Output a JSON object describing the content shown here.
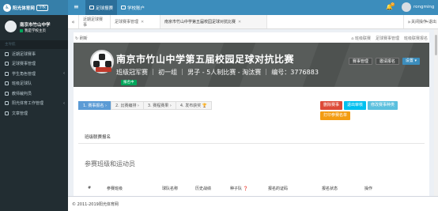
{
  "topbar": {
    "logo_mark": "♿",
    "logo_text": "阳光体育网",
    "logo_badge": "学校",
    "nav": [
      {
        "label": "足球报赛"
      },
      {
        "label": "学校账户"
      }
    ],
    "notification_count": "0",
    "user_name": "rongming"
  },
  "sidebar": {
    "school": "南京市竹山中学",
    "status": "我是学校主页",
    "section_header": "主导航",
    "items": [
      {
        "label": "近期足球赛事"
      },
      {
        "label": "足球赛事管理"
      },
      {
        "label": "学生角色管理"
      },
      {
        "label": "班级足球队"
      },
      {
        "label": "教师裁判员"
      },
      {
        "label": "阳光体育工作管理"
      },
      {
        "label": "文章管理"
      }
    ]
  },
  "tabs": {
    "items": [
      {
        "label": "近期足球赛事"
      },
      {
        "label": "足球赛事管理"
      },
      {
        "label": "南京市竹山中学第五届校园足球对抗比赛"
      }
    ],
    "close_ops": "关闭操作",
    "exit": "退出"
  },
  "page": {
    "refresh": "刷新",
    "links": [
      "班级联赛",
      "足球赛事管理",
      "班级联赛报名"
    ],
    "hero": {
      "title": "南京市竹山中学第五届校园足球对抗比赛",
      "subtitle": "班级冠军赛 ｜ 初一组 ｜ 男子 - 5人制比赛 - 淘汰赛 ｜ 编号：3776883",
      "badge": "报名中",
      "buttons": {
        "manage": "赛事管理",
        "invite": "邀请报名",
        "settings": "设置 ▾"
      }
    },
    "steps": [
      {
        "label": "1. 赛事报名 ›"
      },
      {
        "label": "2. 比赛编排 ›"
      },
      {
        "label": "3. 赛程赛果 ›"
      },
      {
        "label": "4. 发布获奖 🏆"
      }
    ],
    "actions": [
      {
        "label": "删除赛事",
        "color": "#dd4b39"
      },
      {
        "label": "退出审核",
        "color": "#00c0ef"
      },
      {
        "label": "修改赛事种类",
        "color": "#5bc0de"
      },
      {
        "label": "打印参赛名单",
        "color": "#f39c12"
      }
    ],
    "section_title": "班级联赛报名",
    "section_subtitle": "参赛班级和运动员",
    "table_headers": [
      "#",
      "参赛班级",
      "球队名称",
      "历史战绩",
      "种子队 ❓",
      "报名的证码",
      "报名状态",
      "操作"
    ]
  },
  "footer": {
    "text": "© 2011-2019阳光体育网"
  }
}
